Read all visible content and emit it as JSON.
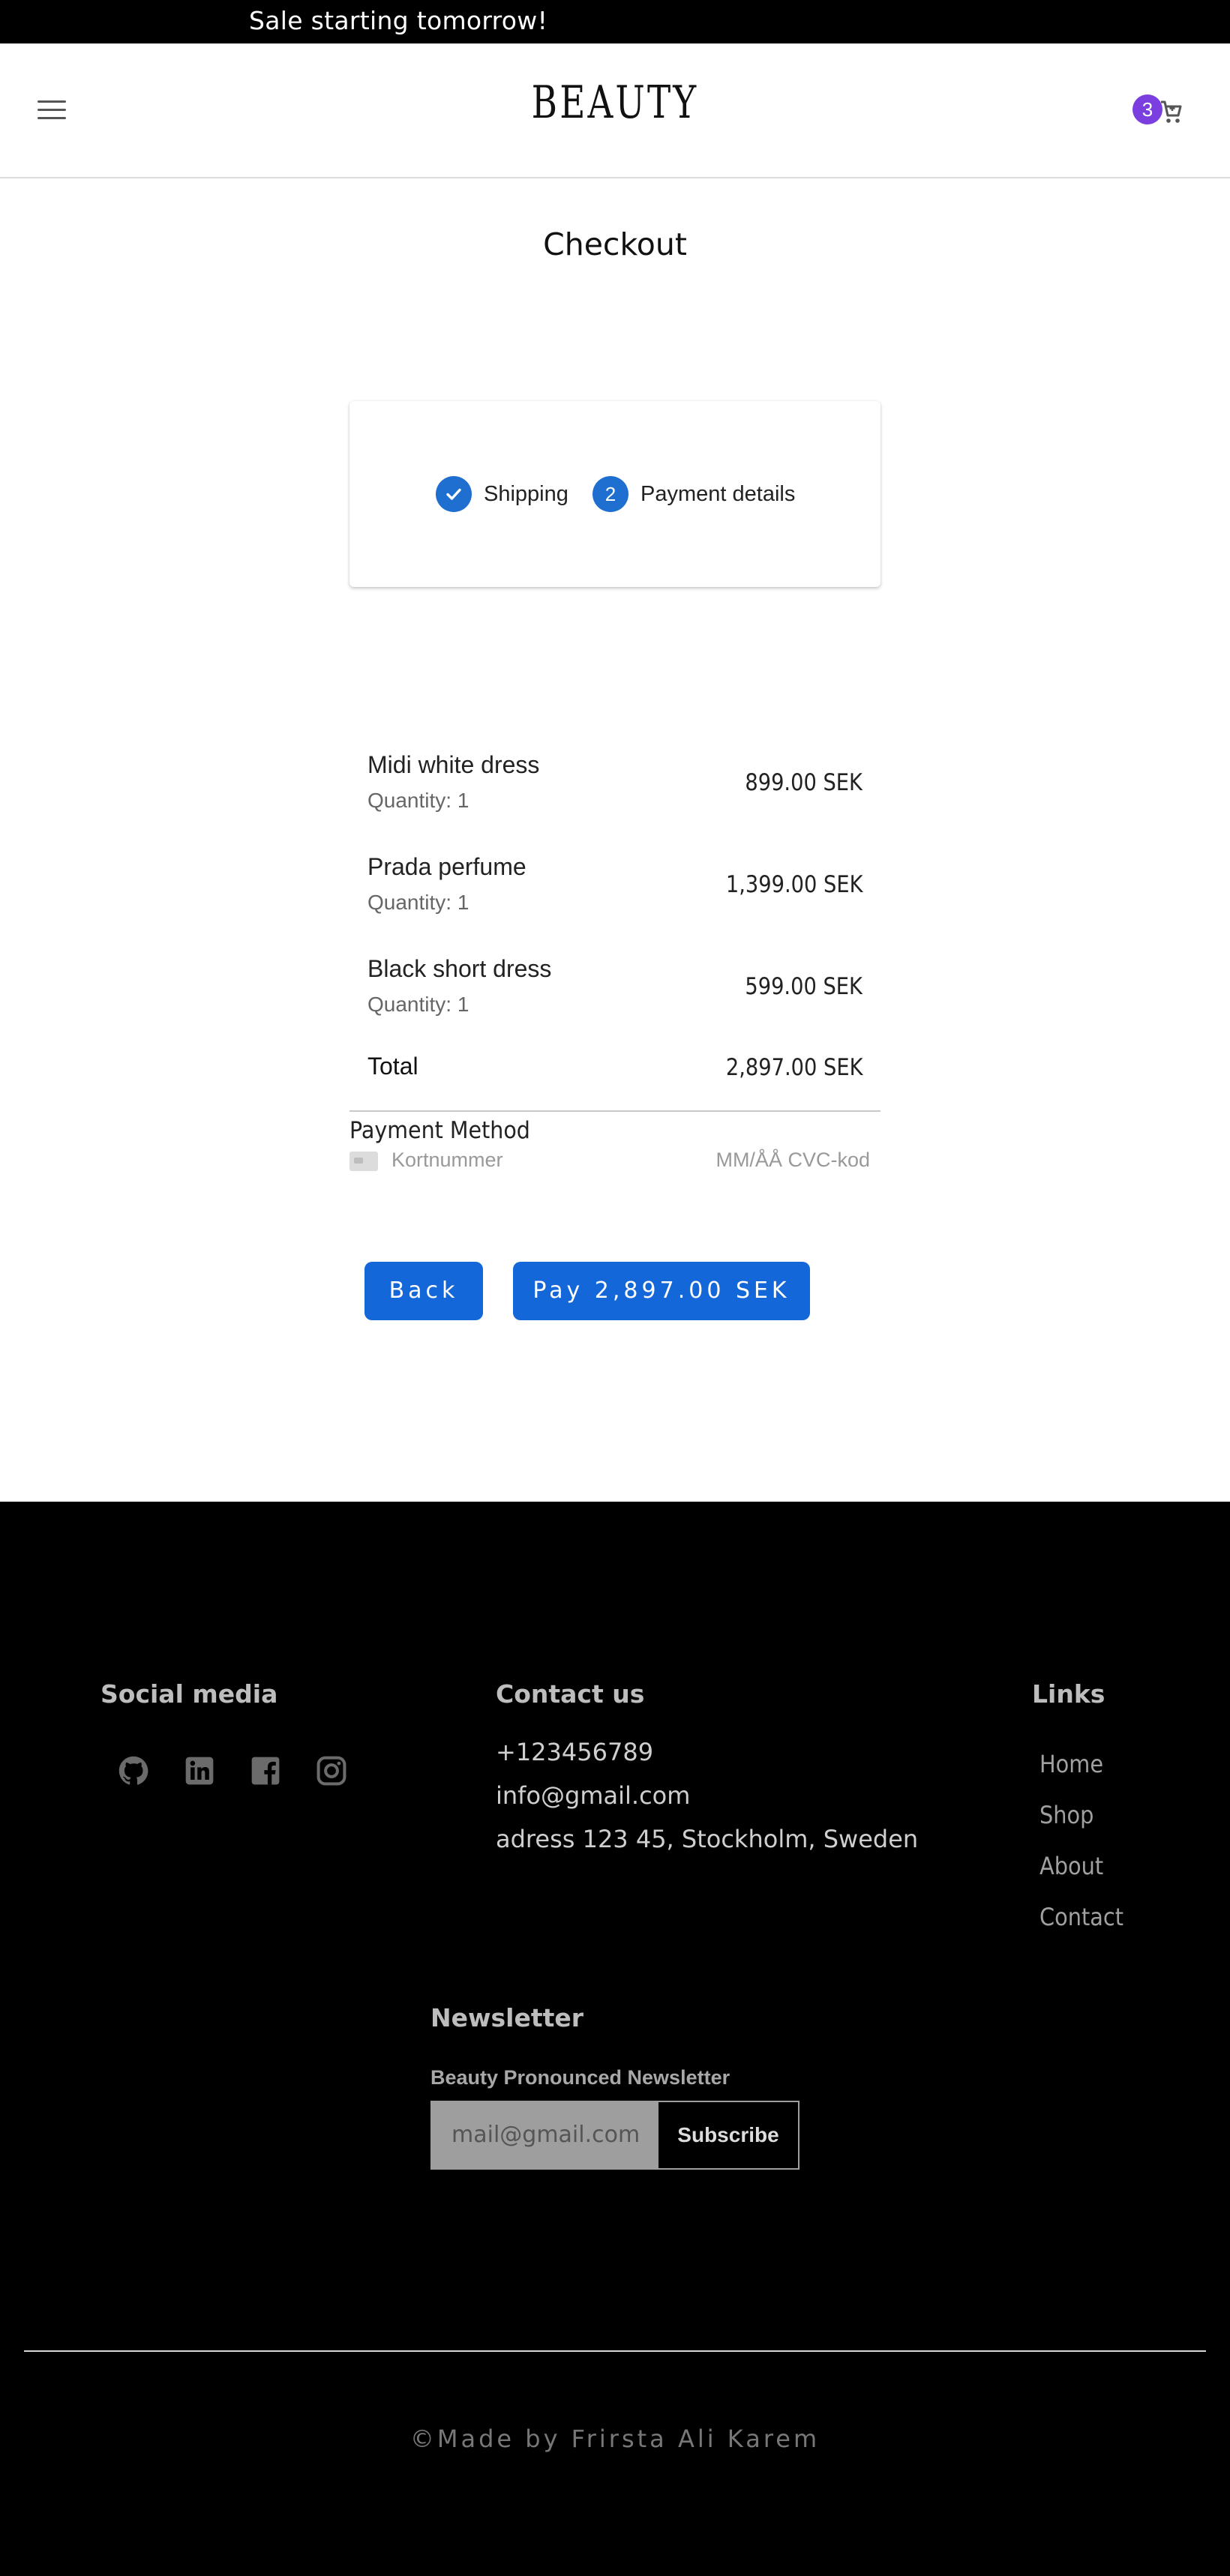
{
  "announcement": {
    "text": "Sale starting tomorrow!"
  },
  "header": {
    "logo": "BEAUTY",
    "menu_icon": "hamburger-menu-icon",
    "cart_icon": "shopping-cart-icon",
    "cart_count": "3",
    "badge_color": "#7b3fe0"
  },
  "page": {
    "title": "Checkout"
  },
  "stepper": {
    "steps": [
      {
        "label": "Shipping",
        "status": "completed",
        "icon": "check-icon"
      },
      {
        "number": "2",
        "label": "Payment details",
        "status": "active"
      }
    ],
    "accent_color": "#1f6fd1"
  },
  "order": {
    "items": [
      {
        "name": "Midi white dress",
        "quantity": "Quantity: 1",
        "price": "899.00 SEK"
      },
      {
        "name": "Prada perfume",
        "quantity": "Quantity: 1",
        "price": "1,399.00 SEK"
      },
      {
        "name": "Black short dress",
        "quantity": "Quantity: 1",
        "price": "599.00 SEK"
      }
    ],
    "total_label": "Total",
    "total_price": "2,897.00 SEK"
  },
  "payment": {
    "title": "Payment Method",
    "card_icon": "credit-card-icon",
    "card_number_placeholder": "Kortnummer",
    "expiry_cvc_placeholder": "MM/ÅÅ CVC-kod"
  },
  "actions": {
    "back_label": "Back",
    "pay_label": "Pay 2,897.00 SEK",
    "button_color": "#1467d8"
  },
  "footer": {
    "social": {
      "title": "Social media",
      "icons": [
        "github-icon",
        "linkedin-icon",
        "facebook-icon",
        "instagram-icon"
      ]
    },
    "contact": {
      "title": "Contact us",
      "phone": "+123456789",
      "email": "info@gmail.com",
      "address": "adress 123 45, Stockholm, Sweden"
    },
    "links": {
      "title": "Links",
      "items": [
        "Home",
        "Shop",
        "About",
        "Contact"
      ]
    },
    "newsletter": {
      "title": "Newsletter",
      "subtitle": "Beauty Pronounced Newsletter",
      "placeholder": "mail@gmail.com",
      "button": "Subscribe"
    },
    "copyright": "©Made by Frirsta Ali Karem"
  }
}
